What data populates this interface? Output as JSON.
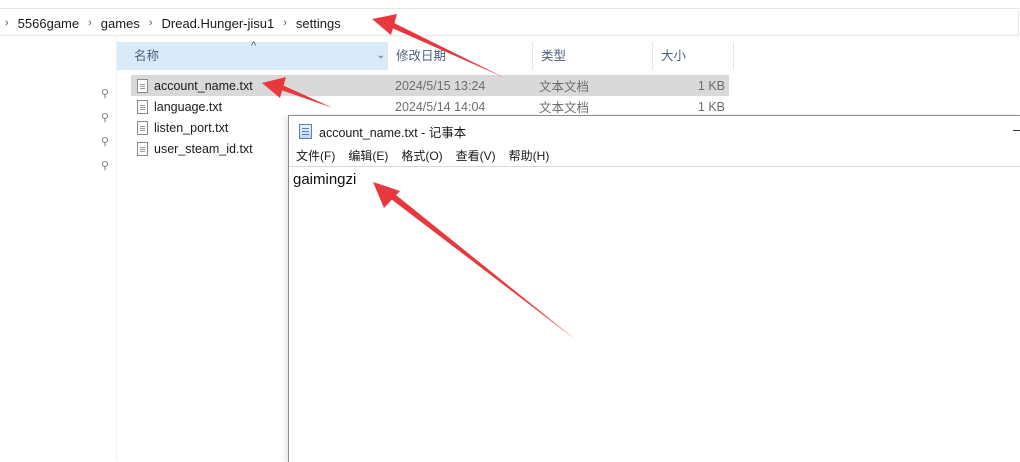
{
  "explorer": {
    "breadcrumb": [
      "5566game",
      "games",
      "Dread.Hunger-jisu1",
      "settings"
    ],
    "columns": {
      "name": "名称",
      "date": "修改日期",
      "type": "类型",
      "size": "大小"
    },
    "files": [
      {
        "name": "account_name.txt",
        "date": "2024/5/15 13:24",
        "type": "文本文档",
        "size": "1 KB"
      },
      {
        "name": "language.txt",
        "date": "2024/5/14 14:04",
        "type": "文本文档",
        "size": "1 KB"
      },
      {
        "name": "listen_port.txt",
        "date": "",
        "type": "",
        "size": ""
      },
      {
        "name": "user_steam_id.txt",
        "date": "",
        "type": "",
        "size": ""
      }
    ]
  },
  "notepad": {
    "title": "account_name.txt - 记事本",
    "menu": [
      "文件(F)",
      "编辑(E)",
      "格式(O)",
      "查看(V)",
      "帮助(H)"
    ],
    "content": "gaimingzi"
  },
  "icons": {
    "pin": "pin-icon",
    "file": "text-file-icon",
    "notepad": "notepad-icon",
    "chevron": "chevron-right-icon"
  },
  "colors": {
    "selected_row": "#d9d9d9",
    "header_highlight": "#d9ebf9",
    "annotation_arrow": "#e8383d"
  }
}
